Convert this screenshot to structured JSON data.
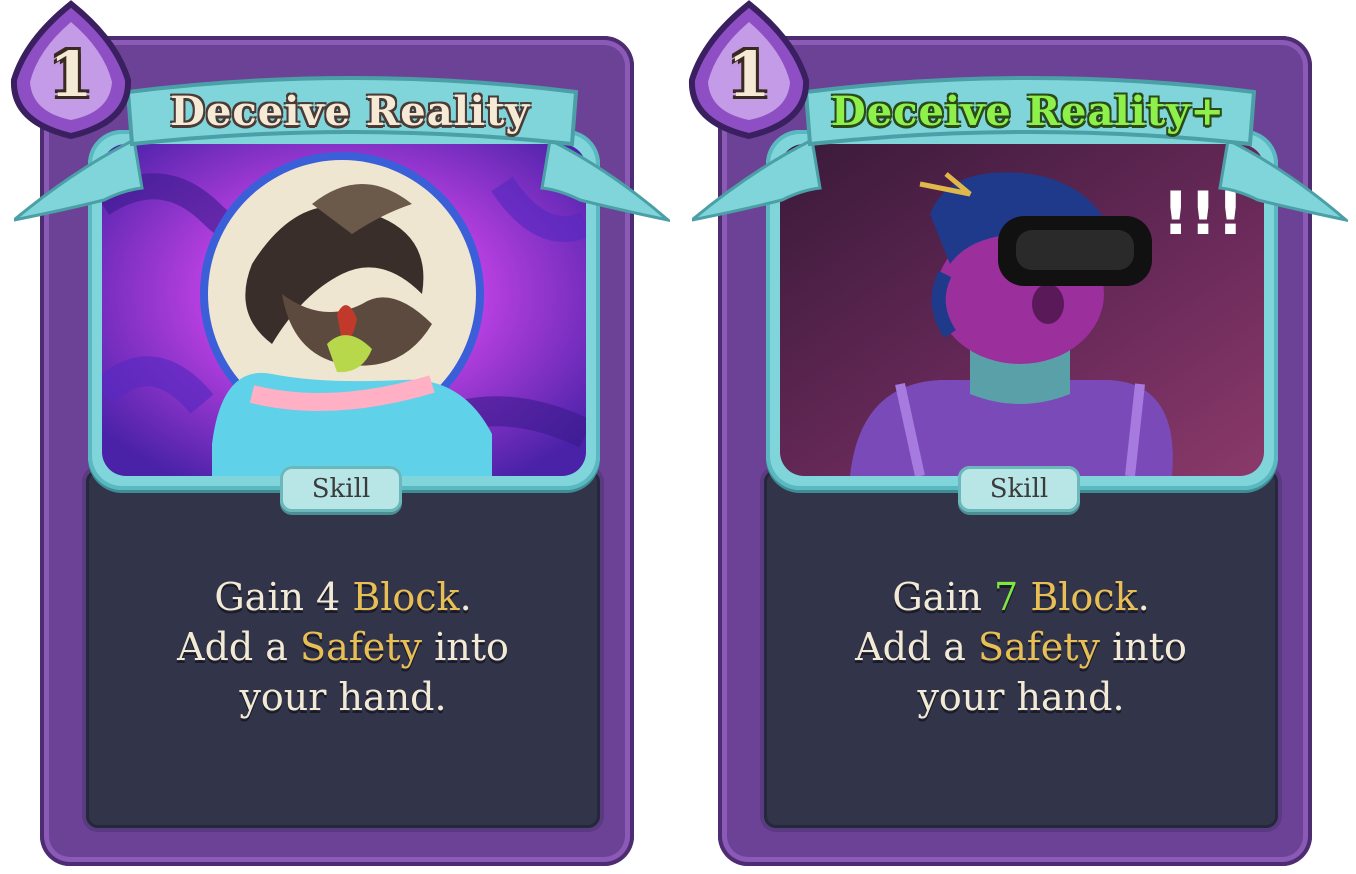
{
  "cards": [
    {
      "cost": "1",
      "title": "Deceive Reality",
      "type": "Skill",
      "description": {
        "line1_a": "Gain ",
        "line1_num": "4",
        "line1_b": " ",
        "line1_kw": "Block",
        "line1_c": ".",
        "line2_a": "Add a ",
        "line2_kw": "Safety",
        "line2_b": " into",
        "line3": "your hand."
      },
      "upgraded": false
    },
    {
      "cost": "1",
      "title": "Deceive Reality+",
      "type": "Skill",
      "description": {
        "line1_a": "Gain ",
        "line1_num": "7",
        "line1_b": " ",
        "line1_kw": "Block",
        "line1_c": ".",
        "line2_a": "Add a ",
        "line2_kw": "Safety",
        "line2_b": " into",
        "line3": "your hand."
      },
      "upgraded": true
    }
  ],
  "colors": {
    "frame_purple": "#6c4296",
    "banner_cyan": "#7fd5da",
    "panel_dark": "#32344a",
    "keyword_gold": "#e8bf55",
    "upgrade_green": "#8ef04a"
  }
}
